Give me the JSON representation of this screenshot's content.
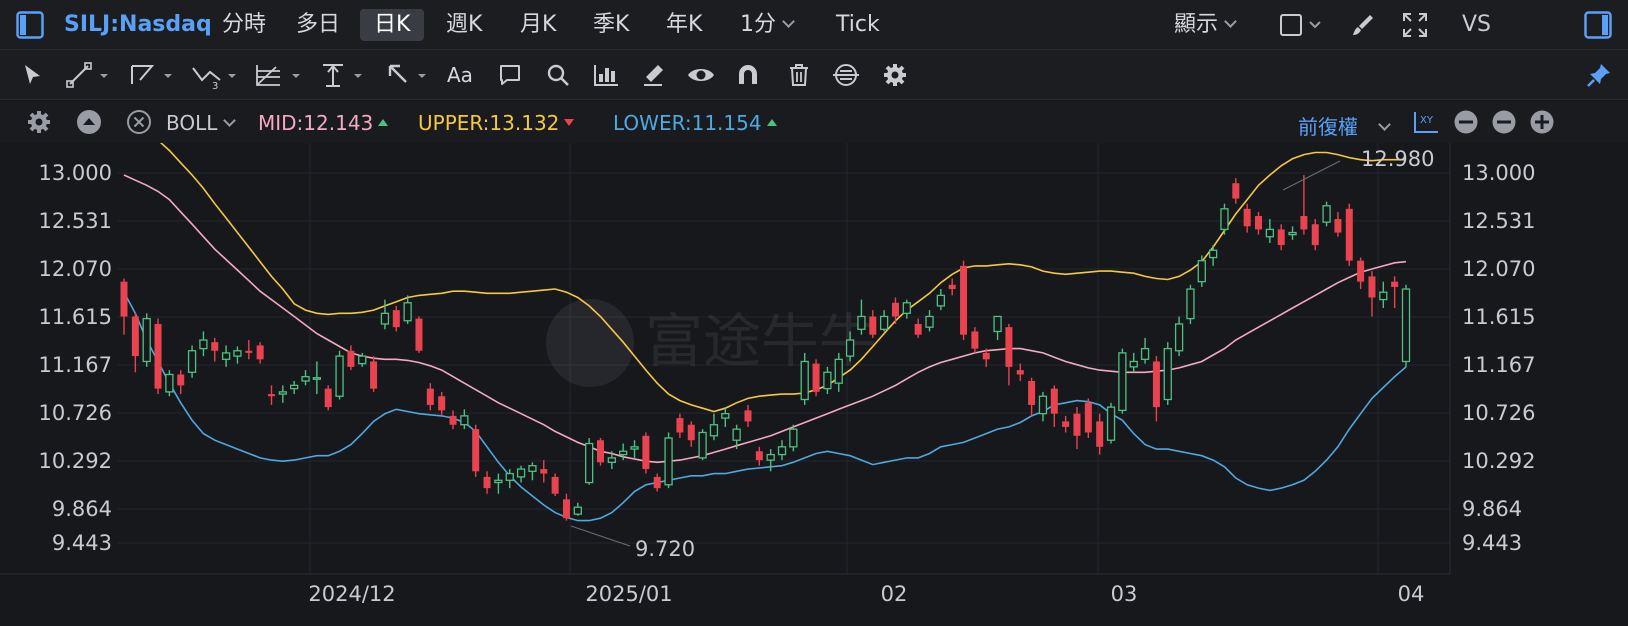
{
  "header": {
    "symbol": "SILJ:Nasdaq",
    "periods": [
      "分時",
      "多日",
      "日K",
      "週K",
      "月K",
      "季K",
      "年K"
    ],
    "active_period": "日K",
    "minute_select": "1分",
    "tick": "Tick",
    "display_menu": "顯示",
    "vs": "VS"
  },
  "toolbar": {
    "tools": [
      "cursor-icon",
      "line-tool-icon",
      "polyline-tool-icon",
      "wave-tool-icon",
      "fib-tool-icon",
      "vertical-tool-icon",
      "arrow-tool-icon",
      "text-tool-icon",
      "comment-tool-icon",
      "search-icon",
      "measure-icon",
      "brush-icon",
      "eye-icon",
      "magnet-icon",
      "trash-icon",
      "sync-icon",
      "settings-icon"
    ],
    "text_tool_label": "Aa"
  },
  "indicator_bar": {
    "indicator": "BOLL",
    "mid": "MID:12.143",
    "upper": "UPPER:13.132",
    "lower": "LOWER:11.154",
    "adjust": "前復權",
    "colors": {
      "mid": "#f4a9c0",
      "upper": "#f5c842",
      "lower": "#4fa8de",
      "up": "#4fc081",
      "down": "#e9434f",
      "accent": "#5aa0f7"
    }
  },
  "chart_data": {
    "type": "candlestick",
    "y_ticks": [
      "13.000",
      "12.531",
      "12.070",
      "11.615",
      "11.167",
      "10.726",
      "10.292",
      "9.864",
      "9.443"
    ],
    "x_ticks": [
      "2024/12",
      "2025/01",
      "02",
      "03",
      "04"
    ],
    "ylim": [
      9.3,
      13.3
    ],
    "annotations": {
      "high": "12.980",
      "low": "9.720"
    },
    "watermark": "富途牛牛",
    "candles": [
      [
        11.95,
        11.62,
        11.98,
        11.45
      ],
      [
        11.62,
        11.25,
        11.65,
        11.1
      ],
      [
        11.2,
        11.6,
        11.65,
        11.15
      ],
      [
        11.55,
        10.95,
        11.6,
        10.9
      ],
      [
        10.92,
        11.08,
        11.12,
        10.88
      ],
      [
        11.08,
        10.98,
        11.12,
        10.9
      ],
      [
        11.1,
        11.3,
        11.35,
        11.05
      ],
      [
        11.32,
        11.4,
        11.48,
        11.25
      ],
      [
        11.38,
        11.3,
        11.42,
        11.2
      ],
      [
        11.22,
        11.28,
        11.35,
        11.15
      ],
      [
        11.25,
        11.3,
        11.34,
        11.18
      ],
      [
        11.3,
        11.28,
        11.4,
        11.22
      ],
      [
        11.35,
        11.22,
        11.38,
        11.18
      ],
      [
        10.9,
        10.88,
        10.98,
        10.8
      ],
      [
        10.9,
        10.92,
        10.98,
        10.82
      ],
      [
        10.95,
        10.98,
        11.02,
        10.9
      ],
      [
        11.02,
        11.06,
        11.12,
        10.98
      ],
      [
        11.05,
        11.05,
        11.2,
        10.9
      ],
      [
        10.95,
        10.78,
        10.98,
        10.75
      ],
      [
        10.88,
        11.25,
        11.3,
        10.85
      ],
      [
        11.3,
        11.15,
        11.35,
        11.12
      ],
      [
        11.18,
        11.25,
        11.28,
        11.15
      ],
      [
        11.2,
        10.95,
        11.25,
        10.92
      ],
      [
        11.55,
        11.65,
        11.78,
        11.5
      ],
      [
        11.68,
        11.52,
        11.72,
        11.48
      ],
      [
        11.58,
        11.75,
        11.82,
        11.55
      ],
      [
        11.6,
        11.3,
        11.62,
        11.28
      ],
      [
        10.95,
        10.8,
        11.0,
        10.75
      ],
      [
        10.88,
        10.75,
        10.92,
        10.7
      ],
      [
        10.7,
        10.62,
        10.75,
        10.58
      ],
      [
        10.62,
        10.7,
        10.76,
        10.58
      ],
      [
        10.58,
        10.2,
        10.62,
        10.15
      ],
      [
        10.15,
        10.05,
        10.2,
        10.0
      ],
      [
        10.1,
        10.12,
        10.18,
        10.0
      ],
      [
        10.12,
        10.18,
        10.22,
        10.05
      ],
      [
        10.15,
        10.22,
        10.25,
        10.1
      ],
      [
        10.2,
        10.25,
        10.28,
        10.12
      ],
      [
        10.22,
        10.18,
        10.3,
        10.1
      ],
      [
        10.15,
        10.0,
        10.18,
        9.98
      ],
      [
        9.95,
        9.75,
        10.0,
        9.72
      ],
      [
        9.8,
        9.88,
        9.92,
        9.78
      ],
      [
        10.1,
        10.45,
        10.5,
        10.08
      ],
      [
        10.48,
        10.28,
        10.5,
        10.25
      ],
      [
        10.28,
        10.32,
        10.38,
        10.22
      ],
      [
        10.35,
        10.38,
        10.45,
        10.3
      ],
      [
        10.4,
        10.42,
        10.48,
        10.32
      ],
      [
        10.52,
        10.22,
        10.55,
        10.18
      ],
      [
        10.15,
        10.05,
        10.18,
        10.02
      ],
      [
        10.08,
        10.5,
        10.55,
        10.05
      ],
      [
        10.68,
        10.55,
        10.72,
        10.5
      ],
      [
        10.62,
        10.48,
        10.65,
        10.42
      ],
      [
        10.32,
        10.55,
        10.58,
        10.3
      ],
      [
        10.52,
        10.62,
        10.72,
        10.48
      ],
      [
        10.68,
        10.72,
        10.78,
        10.6
      ],
      [
        10.48,
        10.58,
        10.62,
        10.4
      ],
      [
        10.75,
        10.65,
        10.8,
        10.6
      ],
      [
        10.38,
        10.3,
        10.42,
        10.25
      ],
      [
        10.3,
        10.35,
        10.4,
        10.2
      ],
      [
        10.35,
        10.42,
        10.48,
        10.3
      ],
      [
        10.42,
        10.58,
        10.62,
        10.38
      ],
      [
        10.85,
        11.2,
        11.28,
        10.8
      ],
      [
        11.18,
        10.92,
        11.22,
        10.88
      ],
      [
        10.95,
        11.1,
        11.15,
        10.9
      ],
      [
        11.0,
        11.22,
        11.28,
        10.92
      ],
      [
        11.25,
        11.4,
        11.48,
        11.2
      ],
      [
        11.5,
        11.62,
        11.78,
        11.45
      ],
      [
        11.62,
        11.45,
        11.68,
        11.42
      ],
      [
        11.5,
        11.62,
        11.68,
        11.48
      ],
      [
        11.75,
        11.62,
        11.8,
        11.55
      ],
      [
        11.65,
        11.75,
        11.78,
        11.6
      ],
      [
        11.55,
        11.45,
        11.6,
        11.42
      ],
      [
        11.52,
        11.62,
        11.68,
        11.48
      ],
      [
        11.72,
        11.82,
        11.88,
        11.68
      ],
      [
        11.92,
        11.88,
        11.98,
        11.82
      ],
      [
        12.1,
        11.45,
        12.15,
        11.4
      ],
      [
        11.48,
        11.32,
        11.52,
        11.28
      ],
      [
        11.28,
        11.22,
        11.32,
        11.15
      ],
      [
        11.48,
        11.62,
        11.58,
        11.4
      ],
      [
        11.52,
        11.15,
        11.55,
        10.98
      ],
      [
        11.12,
        11.08,
        11.18,
        11.02
      ],
      [
        11.02,
        10.8,
        11.05,
        10.7
      ],
      [
        10.72,
        10.88,
        10.92,
        10.65
      ],
      [
        10.95,
        10.72,
        10.98,
        10.6
      ],
      [
        10.65,
        10.6,
        10.7,
        10.55
      ],
      [
        10.72,
        10.52,
        10.78,
        10.4
      ],
      [
        10.82,
        10.55,
        10.86,
        10.5
      ],
      [
        10.65,
        10.42,
        10.72,
        10.35
      ],
      [
        10.48,
        10.78,
        10.82,
        10.45
      ],
      [
        10.75,
        11.28,
        11.32,
        10.72
      ],
      [
        11.15,
        11.2,
        11.28,
        11.1
      ],
      [
        11.22,
        11.32,
        11.42,
        11.18
      ],
      [
        11.2,
        10.78,
        11.25,
        10.65
      ],
      [
        10.85,
        11.32,
        11.38,
        10.8
      ],
      [
        11.3,
        11.55,
        11.62,
        11.25
      ],
      [
        11.6,
        11.88,
        11.92,
        11.55
      ],
      [
        11.95,
        12.15,
        12.2,
        11.9
      ],
      [
        12.18,
        12.25,
        12.3,
        12.1
      ],
      [
        12.45,
        12.65,
        12.7,
        12.4
      ],
      [
        12.9,
        12.75,
        12.95,
        12.7
      ],
      [
        12.65,
        12.48,
        12.7,
        12.42
      ],
      [
        12.58,
        12.45,
        12.62,
        12.4
      ],
      [
        12.38,
        12.45,
        12.55,
        12.32
      ],
      [
        12.45,
        12.3,
        12.5,
        12.25
      ],
      [
        12.4,
        12.42,
        12.48,
        12.35
      ],
      [
        12.58,
        12.45,
        12.98,
        12.4
      ],
      [
        12.5,
        12.3,
        12.55,
        12.25
      ],
      [
        12.52,
        12.68,
        12.72,
        12.48
      ],
      [
        12.55,
        12.42,
        12.62,
        12.38
      ],
      [
        12.65,
        12.15,
        12.7,
        12.1
      ],
      [
        12.15,
        11.95,
        12.18,
        11.88
      ],
      [
        12.0,
        11.8,
        12.05,
        11.62
      ],
      [
        11.78,
        11.85,
        11.95,
        11.7
      ],
      [
        11.95,
        11.9,
        12.0,
        11.7
      ],
      [
        11.2,
        11.88,
        11.92,
        11.15
      ]
    ],
    "mid": [
      12.98,
      12.93,
      12.88,
      12.82,
      12.74,
      12.62,
      12.5,
      12.38,
      12.26,
      12.16,
      12.06,
      11.96,
      11.86,
      11.78,
      11.7,
      11.62,
      11.54,
      11.46,
      11.4,
      11.34,
      11.28,
      11.25,
      11.23,
      11.22,
      11.22,
      11.21,
      11.19,
      11.16,
      11.12,
      11.06,
      11.0,
      10.94,
      10.88,
      10.82,
      10.77,
      10.72,
      10.67,
      10.62,
      10.56,
      10.51,
      10.46,
      10.42,
      10.38,
      10.36,
      10.33,
      10.31,
      10.29,
      10.28,
      10.29,
      10.3,
      10.32,
      10.34,
      10.37,
      10.4,
      10.43,
      10.46,
      10.49,
      10.52,
      10.56,
      10.6,
      10.64,
      10.68,
      10.72,
      10.76,
      10.8,
      10.84,
      10.88,
      10.93,
      10.98,
      11.04,
      11.1,
      11.15,
      11.19,
      11.22,
      11.25,
      11.28,
      11.3,
      11.31,
      11.32,
      11.32,
      11.3,
      11.28,
      11.24,
      11.2,
      11.17,
      11.14,
      11.12,
      11.11,
      11.1,
      11.1,
      11.1,
      11.11,
      11.12,
      11.14,
      11.17,
      11.2,
      11.26,
      11.32,
      11.4,
      11.46,
      11.52,
      11.58,
      11.64,
      11.7,
      11.76,
      11.82,
      11.88,
      11.94,
      11.99,
      12.04,
      12.07,
      12.1,
      12.13,
      12.14
    ],
    "upper": [
      13.55,
      13.48,
      13.4,
      13.32,
      13.22,
      13.1,
      12.98,
      12.85,
      12.7,
      12.56,
      12.42,
      12.28,
      12.14,
      12.0,
      11.88,
      11.74,
      11.68,
      11.65,
      11.64,
      11.65,
      11.65,
      11.66,
      11.68,
      11.72,
      11.76,
      11.8,
      11.82,
      11.83,
      11.84,
      11.86,
      11.86,
      11.85,
      11.84,
      11.84,
      11.84,
      11.85,
      11.86,
      11.87,
      11.88,
      11.85,
      11.8,
      11.72,
      11.62,
      11.5,
      11.38,
      11.25,
      11.12,
      11.0,
      10.9,
      10.84,
      10.8,
      10.77,
      10.74,
      10.77,
      10.82,
      10.86,
      10.88,
      10.89,
      10.9,
      10.9,
      10.91,
      10.94,
      10.98,
      11.05,
      11.12,
      11.22,
      11.34,
      11.46,
      11.58,
      11.68,
      11.76,
      11.84,
      11.94,
      12.02,
      12.08,
      12.1,
      12.1,
      12.11,
      12.12,
      12.11,
      12.09,
      12.05,
      12.03,
      12.02,
      12.03,
      12.04,
      12.05,
      12.05,
      12.04,
      12.03,
      12.0,
      11.98,
      11.97,
      12.0,
      12.06,
      12.14,
      12.28,
      12.44,
      12.6,
      12.74,
      12.88,
      12.98,
      13.07,
      13.14,
      13.18,
      13.2,
      13.2,
      13.18,
      13.15,
      13.13,
      13.12,
      13.13,
      13.13,
      13.13
    ],
    "lower": [
      11.85,
      11.65,
      11.4,
      11.2,
      11.0,
      10.82,
      10.66,
      10.54,
      10.48,
      10.44,
      10.4,
      10.36,
      10.32,
      10.3,
      10.29,
      10.3,
      10.32,
      10.34,
      10.34,
      10.38,
      10.44,
      10.54,
      10.65,
      10.72,
      10.76,
      10.74,
      10.72,
      10.71,
      10.7,
      10.68,
      10.64,
      10.56,
      10.42,
      10.28,
      10.16,
      10.06,
      9.98,
      9.9,
      9.82,
      9.76,
      9.72,
      9.72,
      9.75,
      9.82,
      9.92,
      10.02,
      10.08,
      10.1,
      10.12,
      10.14,
      10.16,
      10.16,
      10.18,
      10.18,
      10.2,
      10.22,
      10.23,
      10.24,
      10.25,
      10.28,
      10.32,
      10.36,
      10.38,
      10.36,
      10.34,
      10.3,
      10.26,
      10.28,
      10.3,
      10.32,
      10.32,
      10.36,
      10.42,
      10.44,
      10.46,
      10.5,
      10.54,
      10.58,
      10.6,
      10.64,
      10.7,
      10.74,
      10.8,
      10.82,
      10.84,
      10.83,
      10.8,
      10.72,
      10.66,
      10.54,
      10.44,
      10.4,
      10.4,
      10.38,
      10.36,
      10.34,
      10.3,
      10.24,
      10.14,
      10.08,
      10.05,
      10.03,
      10.05,
      10.08,
      10.12,
      10.2,
      10.3,
      10.42,
      10.58,
      10.72,
      10.86,
      10.96,
      11.06,
      11.15
    ]
  }
}
